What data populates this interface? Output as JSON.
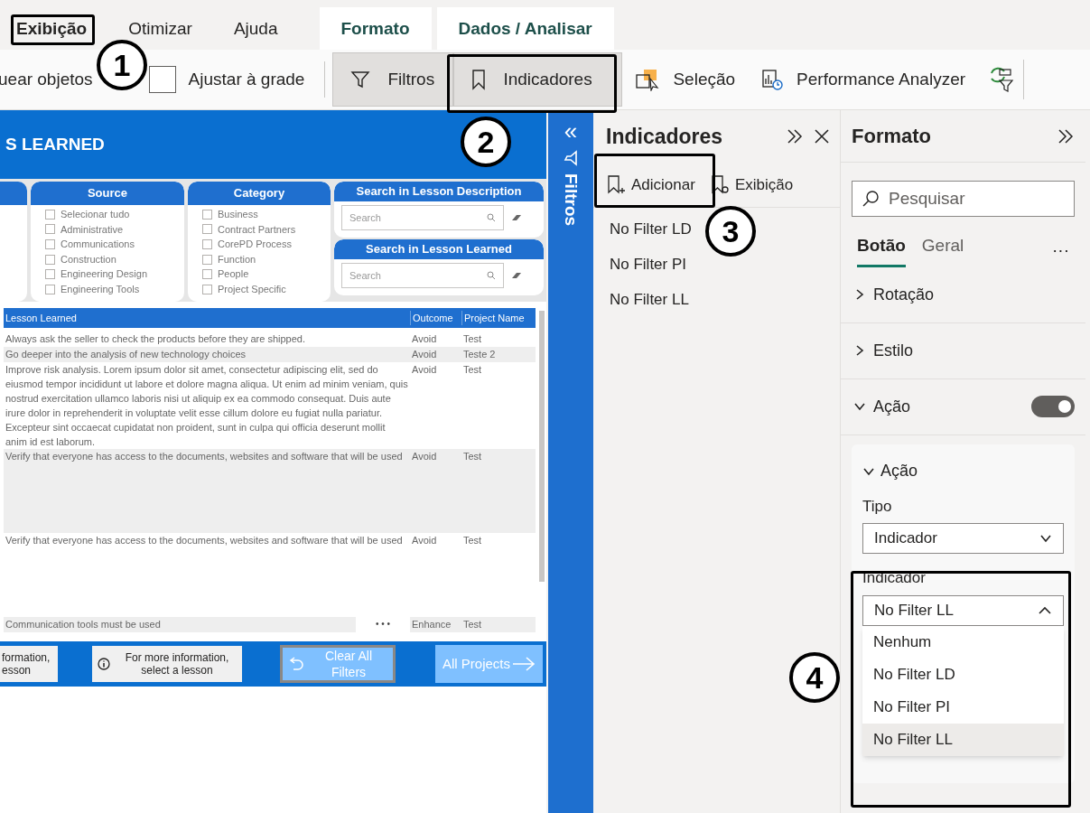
{
  "ribbon_tabs": [
    {
      "label": "Exibição",
      "selected": true,
      "kind": "normal"
    },
    {
      "label": "Otimizar",
      "selected": false,
      "kind": "normal"
    },
    {
      "label": "Ajuda",
      "selected": false,
      "kind": "normal"
    },
    {
      "label": "Formato",
      "selected": false,
      "kind": "contextual"
    },
    {
      "label": "Dados / Analisar",
      "selected": false,
      "kind": "contextual"
    }
  ],
  "toolbar": [
    {
      "kind": "text",
      "label": "uear objetos"
    },
    {
      "kind": "checkbox",
      "label": "Ajustar à grade",
      "checked": false
    },
    {
      "kind": "toggle",
      "label": "Filtros",
      "selected": true
    },
    {
      "kind": "toggle",
      "label": "Indicadores",
      "selected": true
    },
    {
      "kind": "button",
      "label": "Seleção"
    },
    {
      "kind": "button",
      "label": "Performance Analyzer"
    },
    {
      "kind": "icon"
    }
  ],
  "report": {
    "title": "S LEARNED",
    "slicers": [
      {
        "title": "Source",
        "items": [
          {
            "label": "Selecionar tudo",
            "checked": false
          },
          {
            "label": "Administrative",
            "checked": false
          },
          {
            "label": "Communications",
            "checked": false
          },
          {
            "label": "Construction",
            "checked": false
          },
          {
            "label": "Engineering Design",
            "checked": false
          },
          {
            "label": "Engineering Tools",
            "checked": false
          }
        ]
      },
      {
        "title": "Category",
        "items": [
          {
            "label": "Business",
            "checked": false
          },
          {
            "label": "Contract Partners",
            "checked": false
          },
          {
            "label": "CorePD Process",
            "checked": false
          },
          {
            "label": "Function",
            "checked": false
          },
          {
            "label": "People",
            "checked": false
          },
          {
            "label": "Project Specific",
            "checked": false
          }
        ]
      }
    ],
    "searches": [
      {
        "title": "Search in Lesson Description",
        "placeholder": "Search"
      },
      {
        "title": "Search in Lesson Learned",
        "placeholder": "Search"
      }
    ],
    "table": {
      "columns": [
        "Lesson Learned",
        "Outcome",
        "Project Name"
      ],
      "rows": [
        {
          "cells": [
            "Always ask the seller to check the products before they are shipped.",
            "Avoid",
            "Test"
          ]
        },
        {
          "cells": [
            "Go deeper into the analysis of new technology choices",
            "Avoid",
            "Teste 2"
          ]
        },
        {
          "cells": [
            "Improve risk analysis. Lorem ipsum dolor sit amet, consectetur adipiscing elit, sed do eiusmod tempor incididunt ut labore et dolore magna aliqua. Ut enim ad minim veniam, quis nostrud exercitation ullamco laboris nisi ut aliquip ex ea commodo consequat. Duis aute irure dolor in reprehenderit in voluptate velit esse cillum dolore eu fugiat nulla pariatur. Excepteur sint occaecat cupidatat non proident, sunt in culpa qui officia deserunt mollit anim id est laborum.",
            "Avoid",
            "Test"
          ]
        },
        {
          "cells": [
            "Verify that everyone has access to the documents, websites and software that will be used",
            "Avoid",
            "Test"
          ]
        },
        {
          "cells": [
            "Verify that everyone has access to the documents, websites and software that will be used",
            "Avoid",
            "Test"
          ]
        },
        {
          "cells": [
            "Communication tools must be used",
            "Enhance",
            "Test"
          ]
        }
      ],
      "more": "• • •"
    },
    "footer": {
      "cut_card": "formation,\nesson",
      "info": "For more information, select a lesson",
      "clear": "Clear All Filters",
      "all": "All Projects"
    }
  },
  "filters_pane": {
    "label": "Filtros",
    "collapse": "«"
  },
  "bookmarks_pane": {
    "title": "Indicadores",
    "actions": [
      "Adicionar",
      "Exibição"
    ],
    "items": [
      "No Filter LD",
      "No Filter PI",
      "No Filter LL"
    ]
  },
  "format_pane": {
    "title": "Formato",
    "search_placeholder": "Pesquisar",
    "tabs": [
      {
        "label": "Botão",
        "selected": true
      },
      {
        "label": "Geral",
        "selected": false
      }
    ],
    "more": "···",
    "sections": [
      {
        "label": "Rotação",
        "expanded": false
      },
      {
        "label": "Estilo",
        "expanded": false
      },
      {
        "label": "Ação",
        "expanded": true,
        "on": true
      }
    ],
    "action_card": {
      "label": "Ação",
      "expanded": true,
      "type_label": "Tipo",
      "type_value": "Indicador",
      "bookmark_label": "Indicador",
      "bookmark_value": "No Filter LL",
      "open": true,
      "options": [
        {
          "label": "Nenhum",
          "selected": false
        },
        {
          "label": "No Filter LD",
          "selected": false
        },
        {
          "label": "No Filter PI",
          "selected": false
        },
        {
          "label": "No Filter LL",
          "selected": true
        }
      ]
    }
  },
  "callouts": [
    "1",
    "2",
    "3",
    "4"
  ]
}
